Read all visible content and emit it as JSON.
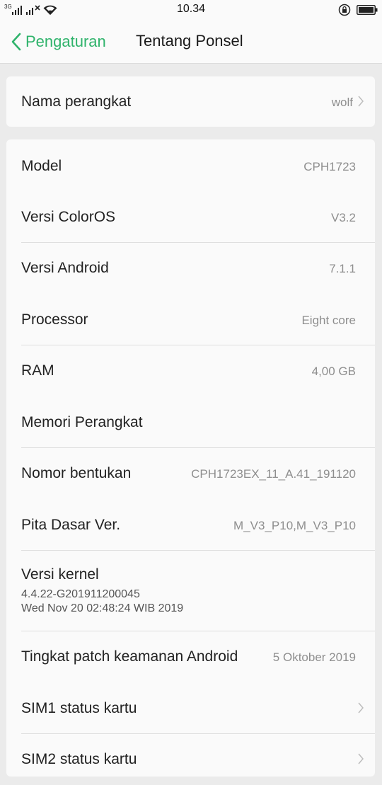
{
  "status_bar": {
    "network_label": "3G",
    "time": "10.34",
    "icons": [
      "signal-icon",
      "signal-no-sim-icon",
      "wifi-icon",
      "rotation-lock-icon",
      "battery-icon"
    ]
  },
  "header": {
    "back_label": "Pengaturan",
    "title": "Tentang Ponsel"
  },
  "device_name": {
    "label": "Nama perangkat",
    "value": "wolf"
  },
  "info_rows": [
    {
      "label": "Model",
      "value": "CPH1723"
    },
    {
      "label": "Versi ColorOS",
      "value": "V3.2"
    },
    {
      "label": "Versi Android",
      "value": "7.1.1"
    },
    {
      "label": "Processor",
      "value": "Eight core"
    },
    {
      "label": "RAM",
      "value": "4,00 GB"
    },
    {
      "label": "Memori Perangkat",
      "value": ""
    },
    {
      "label": "Nomor bentukan",
      "value": "CPH1723EX_11_A.41_191120"
    },
    {
      "label": "Pita Dasar Ver.",
      "value": "M_V3_P10,M_V3_P10"
    }
  ],
  "kernel": {
    "label": "Versi kernel",
    "line1": "4.4.22-G201911200045",
    "line2": "Wed Nov 20 02:48:24 WIB 2019"
  },
  "patch": {
    "label": "Tingkat patch keamanan Android",
    "value": "5 Oktober 2019"
  },
  "sim_rows": [
    {
      "label": "SIM1 status kartu"
    },
    {
      "label": "SIM2 status kartu"
    }
  ],
  "colors": {
    "accent": "#2fb36b",
    "background": "#ebebeb",
    "card": "#fafafa",
    "secondary_text": "#8e8e8e"
  }
}
